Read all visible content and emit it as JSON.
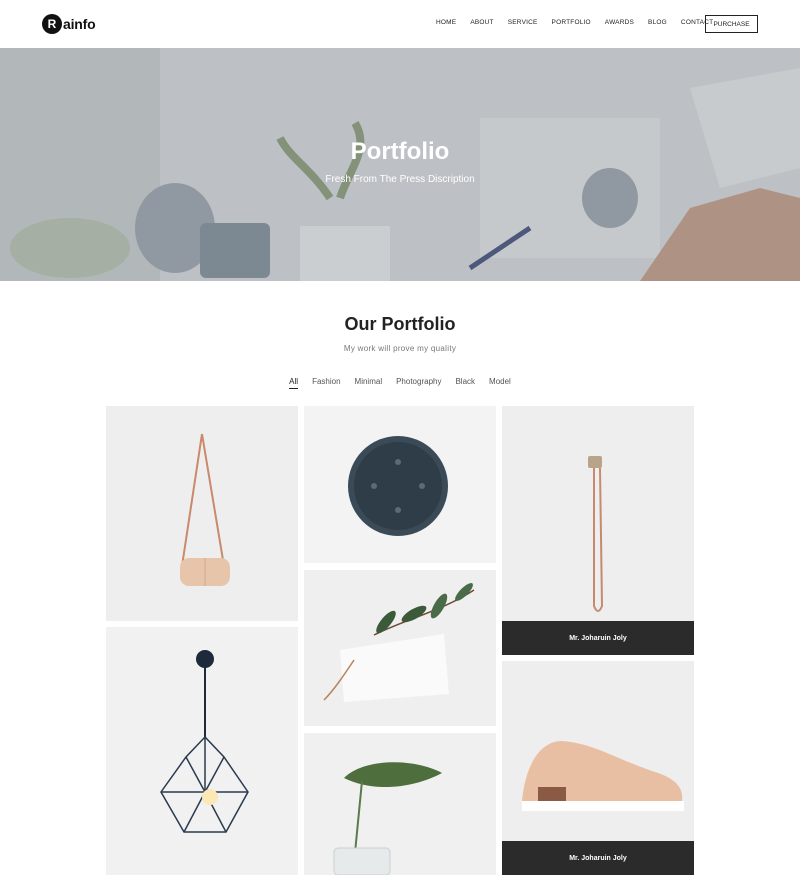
{
  "brand": {
    "logo_letter": "R",
    "logo_text": "ainfo"
  },
  "nav": {
    "items": [
      "Home",
      "About",
      "Service",
      "Portfolio",
      "Awards",
      "Blog",
      "Contact"
    ],
    "purchase_label": "Purchase"
  },
  "hero": {
    "title": "Portfolio",
    "subtitle": "Fresh From The Press Discription"
  },
  "portfolio": {
    "title": "Our Portfolio",
    "subtitle": "My work will prove my quality",
    "filters": [
      "All",
      "Fashion",
      "Minimal",
      "Photography",
      "Black",
      "Model"
    ],
    "active_filter": "All",
    "items": [
      {
        "subject": "bag",
        "caption": ""
      },
      {
        "subject": "smart-speaker",
        "caption": ""
      },
      {
        "subject": "safety-pin",
        "caption": "Mr. Joharuin Joly"
      },
      {
        "subject": "pendant-lamp",
        "caption": ""
      },
      {
        "subject": "eucalyptus-card",
        "caption": ""
      },
      {
        "subject": "sneaker",
        "caption": "Mr. Joharuin Joly"
      },
      {
        "subject": "monstera-vase",
        "caption": ""
      }
    ]
  },
  "colors": {
    "caption_bg": "#2b2b2b",
    "tile_bg": "#ececec",
    "text_dark": "#222222"
  }
}
